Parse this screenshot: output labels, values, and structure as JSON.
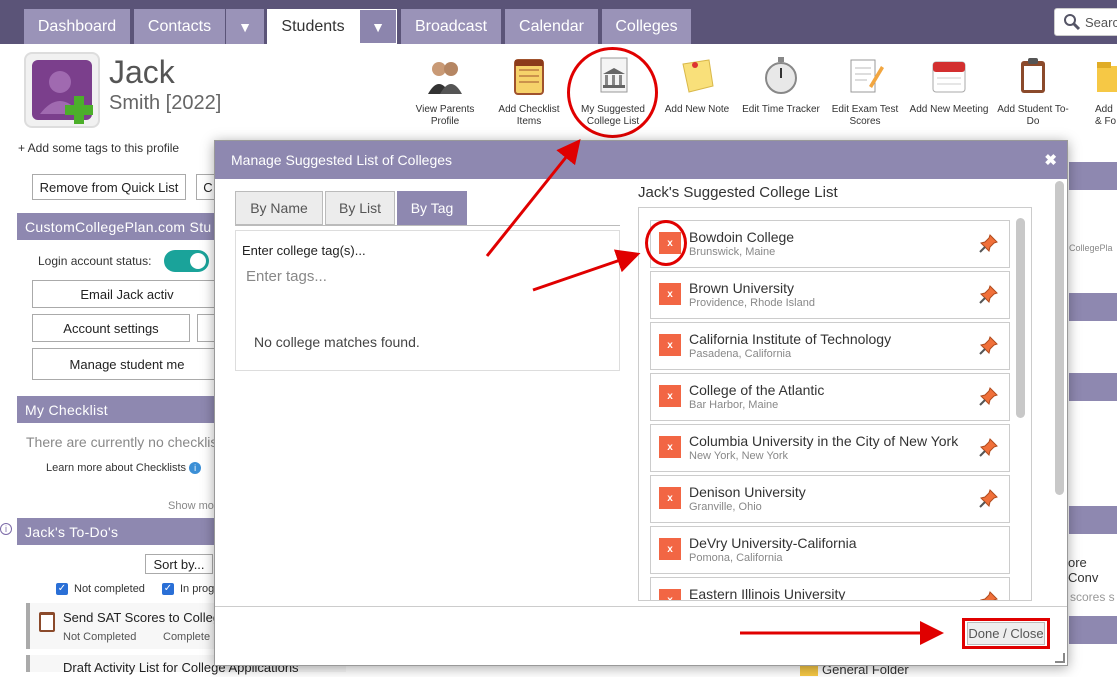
{
  "nav": {
    "tabs": [
      "Dashboard",
      "Contacts",
      "Students",
      "Broadcast",
      "Calendar",
      "Colleges"
    ],
    "search_label": "Searc"
  },
  "student": {
    "first_name": "Jack",
    "last_name": "Smith [2022]",
    "tags_link": "+ Add some tags to this profile"
  },
  "toolbar": [
    {
      "label": "View Parents Profile",
      "icon": "parents-icon"
    },
    {
      "label": "Add Checklist Items",
      "icon": "checklist-icon"
    },
    {
      "label": "My Suggested College List",
      "icon": "college-list-icon"
    },
    {
      "label": "Add New Note",
      "icon": "note-icon"
    },
    {
      "label": "Edit Time Tracker",
      "icon": "stopwatch-icon"
    },
    {
      "label": "Edit Exam Test Scores",
      "icon": "exam-icon"
    },
    {
      "label": "Add New Meeting",
      "icon": "calendar-icon"
    },
    {
      "label": "Add Student To-Do",
      "icon": "clipboard-icon"
    },
    {
      "label": "Add & Fo",
      "icon": "folder-icon"
    }
  ],
  "left": {
    "remove_quick_list": "Remove from Quick List",
    "ccp_section": "CustomCollegePlan.com Stu",
    "login_status_label": "Login account status:",
    "email_btn": "Email Jack activ",
    "account_settings": "Account settings",
    "manage_student": "Manage student me",
    "checklist_title": "My Checklist",
    "checklist_empty": "There are currently no checklis",
    "learn_more": "Learn more about Checklists",
    "show_more": "Show mo",
    "todo_title": "Jack's To-Do's",
    "sort_by": "Sort by...",
    "filter_not_completed": "Not completed",
    "filter_in_progress": "In prog",
    "todo_items": [
      {
        "title": "Send SAT Scores to Colleg",
        "status": "Not Completed",
        "status2": "Complete"
      },
      {
        "title": "Draft Activity List for College Applications",
        "status": "",
        "status2": ""
      }
    ]
  },
  "right_peek": {
    "ccp": "CollegePla",
    "convo": "ore Conv",
    "scores": "scores s",
    "folder": "General Folder"
  },
  "modal": {
    "title": "Manage Suggested List of Colleges",
    "close": "✖",
    "tabs": [
      "By Name",
      "By List",
      "By Tag"
    ],
    "tag_label": "Enter college tag(s)...",
    "tag_placeholder": "Enter tags...",
    "no_match": "No college matches found.",
    "list_title": "Jack's Suggested College List",
    "colleges": [
      {
        "name": "Bowdoin College",
        "location": "Brunswick, Maine",
        "pinned": true
      },
      {
        "name": "Brown University",
        "location": "Providence, Rhode Island",
        "pinned": true
      },
      {
        "name": "California Institute of Technology",
        "location": "Pasadena, California",
        "pinned": true
      },
      {
        "name": "College of the Atlantic",
        "location": "Bar Harbor, Maine",
        "pinned": true
      },
      {
        "name": "Columbia University in the City of New York",
        "location": "New York, New York",
        "pinned": true
      },
      {
        "name": "Denison University",
        "location": "Granville, Ohio",
        "pinned": true
      },
      {
        "name": "DeVry University-California",
        "location": "Pomona, California",
        "pinned": false
      },
      {
        "name": "Eastern Illinois University",
        "location": "",
        "pinned": true
      }
    ],
    "remove_symbol": "x",
    "done": "Done / Close"
  },
  "colors": {
    "nav_bg": "#5b5478",
    "tab_bg": "#9a93b8",
    "section_bg": "#8e88b0",
    "remove_btn": "#f26644",
    "annotation": "#e00000"
  }
}
